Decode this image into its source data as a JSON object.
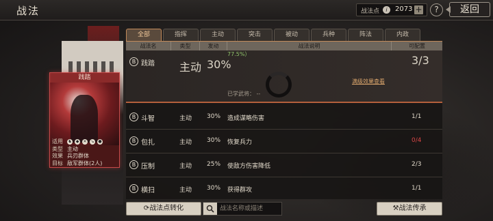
{
  "header": {
    "title": "战法",
    "points_label": "战法点",
    "points_value": "2073",
    "plus_label": "+",
    "help_label": "?",
    "back_label": "返回"
  },
  "tabs": [
    {
      "label": "全部",
      "active": true
    },
    {
      "label": "指挥",
      "active": false
    },
    {
      "label": "主动",
      "active": false
    },
    {
      "label": "突击",
      "active": false
    },
    {
      "label": "被动",
      "active": false
    },
    {
      "label": "兵种",
      "active": false
    },
    {
      "label": "阵法",
      "active": false
    },
    {
      "label": "内政",
      "active": false
    }
  ],
  "table": {
    "columns": [
      "战法名",
      "类型",
      "发动",
      "战法说明",
      "可配置"
    ],
    "expanded_row": {
      "badge": "B",
      "name": "践踏",
      "type": "主动",
      "rate": "30%",
      "desc_fragment": "77.5%）",
      "capacity": "3/3",
      "full_effect_link": "满级效果查看",
      "learned_label": "已学武将：  --"
    },
    "rows": [
      {
        "badge": "B",
        "name": "斗智",
        "type": "主动",
        "rate": "30%",
        "desc": "造成谋略伤害",
        "capacity": "1/1",
        "capacity_color": "normal"
      },
      {
        "badge": "B",
        "name": "包扎",
        "type": "主动",
        "rate": "30%",
        "desc": "恢复兵力",
        "capacity": "0/4",
        "capacity_color": "red"
      },
      {
        "badge": "B",
        "name": "压制",
        "type": "主动",
        "rate": "25%",
        "desc": "使敌方伤害降低",
        "capacity": "2/3",
        "capacity_color": "normal"
      },
      {
        "badge": "B",
        "name": "横扫",
        "type": "主动",
        "rate": "30%",
        "desc": "获得群攻",
        "capacity": "1/1",
        "capacity_color": "normal"
      }
    ]
  },
  "card": {
    "title": "践踏",
    "rows": [
      {
        "key": "适用",
        "value": ""
      },
      {
        "key": "类型",
        "value": "主动"
      },
      {
        "key": "效果",
        "value": "兵刃群体"
      },
      {
        "key": "目标",
        "value": "敌军群体(2人)"
      }
    ],
    "icons": [
      "cavalry-icon",
      "shield-icon",
      "bow-icon",
      "spear-icon",
      "vehicle-icon"
    ]
  },
  "bottom": {
    "convert_label": "战法点转化",
    "search_placeholder": "战法名称或描述",
    "inherit_label": "战法传承"
  },
  "colors": {
    "accent": "#c28a5a",
    "red": "#d64545",
    "green": "#8fc26a"
  }
}
